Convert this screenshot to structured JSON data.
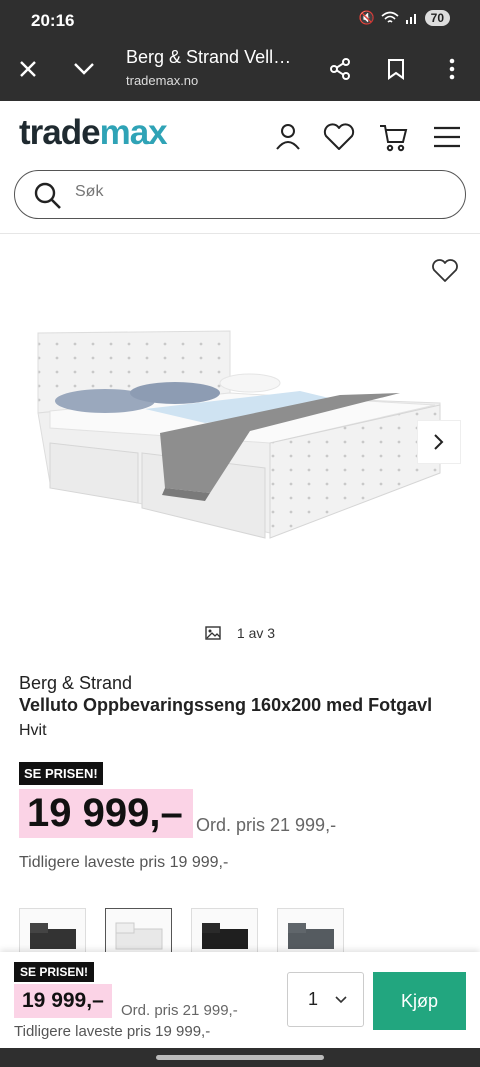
{
  "status_bar": {
    "time": "20:16",
    "battery": "70"
  },
  "tab": {
    "title": "Berg & Strand Vell…",
    "url": "trademax.no"
  },
  "header": {
    "logo_part1": "trade",
    "logo_part2": "max",
    "search_placeholder": "Søk"
  },
  "gallery": {
    "counter": "1 av 3"
  },
  "product": {
    "brand": "Berg & Strand",
    "name": "Velluto Oppbevaringsseng 160x200 med Fotgavl",
    "color": "Hvit",
    "badge": "SE PRISEN!",
    "price": "19 999,–",
    "ordinary": "Ord. pris 21 999,-",
    "lowest": "Tidligere laveste pris 19 999,-"
  },
  "buy_bar": {
    "badge": "SE PRISEN!",
    "price": "19 999,–",
    "ordinary": "Ord. pris 21 999,-",
    "lowest": "Tidligere laveste pris 19 999,-",
    "quantity": "1",
    "buy_label": "Kjøp"
  },
  "colors": {
    "accent_green": "#22a67f",
    "price_highlight": "#fbd3e6",
    "logo_teal": "#2fa3b6"
  }
}
